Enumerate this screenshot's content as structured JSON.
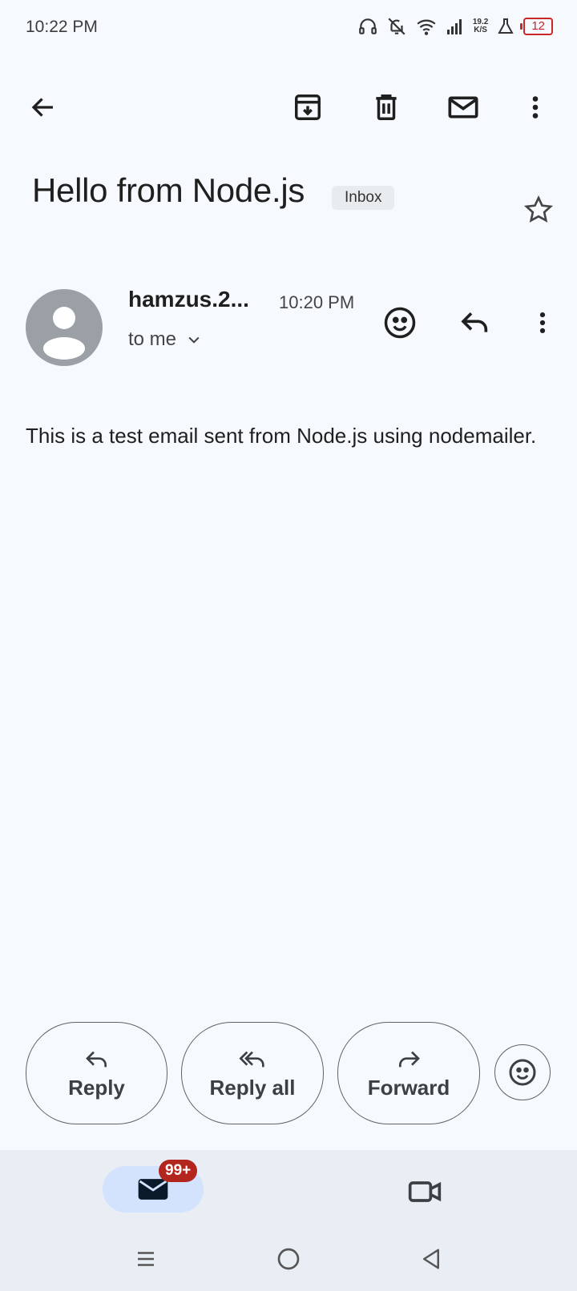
{
  "status_bar": {
    "time": "10:22 PM",
    "net_speed_value": "19.2",
    "net_speed_unit": "K/S",
    "battery": "12"
  },
  "toolbar": {
    "icons": [
      "back-arrow-icon",
      "archive-icon",
      "delete-icon",
      "mark-unread-icon",
      "more-vert-icon"
    ]
  },
  "email": {
    "subject": "Hello from Node.js",
    "label": "Inbox",
    "sender": "hamzus.2...",
    "time": "10:20 PM",
    "recipient": "to me",
    "body": "This is a test email sent from Node.js using nodemailer."
  },
  "actions": {
    "reply": "Reply",
    "reply_all": "Reply all",
    "forward": "Forward"
  },
  "bottom_nav": {
    "mail_badge": "99+"
  },
  "colors": {
    "background": "#f6f9fd",
    "badge": "#b3261e",
    "active_pill": "#d3e3fd",
    "battery_low": "#c62828"
  }
}
